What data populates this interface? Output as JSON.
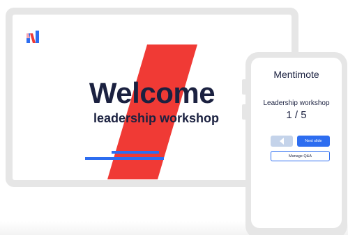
{
  "slide": {
    "logo_icon": "mentimeter-logo-icon",
    "heading": "Welcome",
    "subheading": "leadership workshop",
    "accent_red": "#f03a35",
    "accent_blue": "#2d6df0",
    "text_color": "#1b2140"
  },
  "remote": {
    "app_title": "Mentimote",
    "presentation_title": "Leadership workshop",
    "slide_counter": "1 / 5",
    "prev_icon": "chevron-left-icon",
    "next_label": "Next slide",
    "qa_label": "Manage Q&A"
  }
}
